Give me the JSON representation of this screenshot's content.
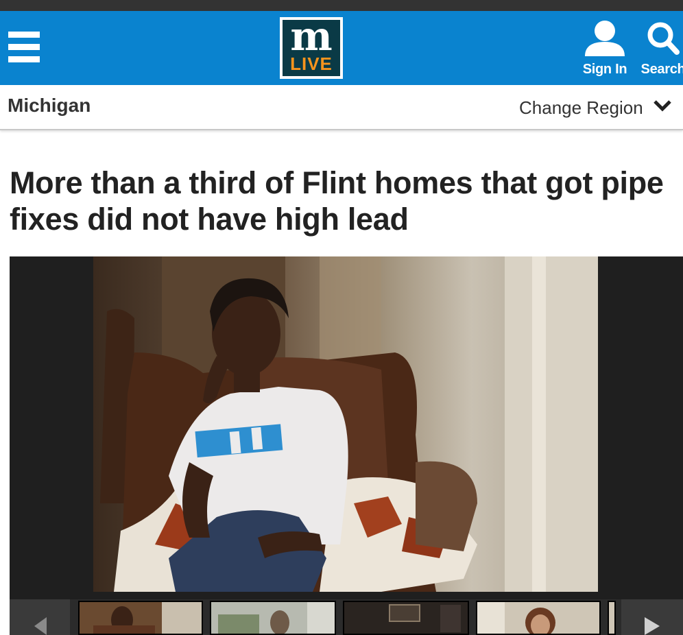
{
  "header": {
    "logo": {
      "line1": "m",
      "line2": "LIVE"
    },
    "signin_label": "Sign In",
    "search_label": "Search"
  },
  "region_bar": {
    "region": "Michigan",
    "change_label": "Change Region"
  },
  "article": {
    "headline": "More than a third of Flint homes that got pipe fixes did not have high lead"
  },
  "colors": {
    "header_bg": "#0a83cf",
    "logo_bg": "#0a3a46",
    "logo_accent": "#f7941d",
    "top_strip": "#333333",
    "gallery_bg": "#1f1f1f"
  },
  "icons": [
    "menu-icon",
    "user-icon",
    "search-icon",
    "chevron-down-icon",
    "chevron-left-icon",
    "chevron-right-icon"
  ]
}
